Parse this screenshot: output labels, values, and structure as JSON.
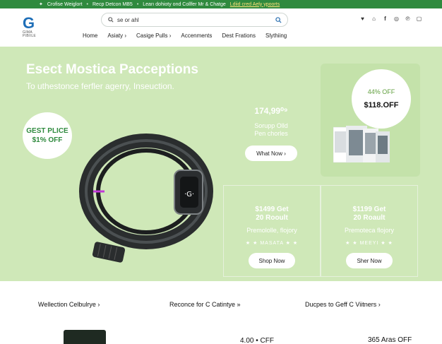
{
  "topbar": {
    "items": [
      "Crofise Weiglort",
      "Recp Detcon MB5",
      "Learı dohioty ond Collfer Mr & Chatge"
    ],
    "highlight": "Ldiid cred Aely ypoorts"
  },
  "header": {
    "logo_letter": "G",
    "logo_text": "GIMA PIBIILE",
    "search": {
      "value": "se or ahl"
    },
    "nav": [
      "Home",
      "Asiaty ›",
      "Casige Pulls ›",
      "Accenments",
      "Dest Frations",
      "Slythiing"
    ],
    "icons": [
      "heart-icon",
      "home-icon",
      "facebook-icon",
      "instagram-icon",
      "pinterest-icon",
      "copy-icon"
    ]
  },
  "hero": {
    "title": "Esect Mostica Pacceptions",
    "subtitle": "To uthestonce ferfler agerry, Inseuction.",
    "badge": {
      "line1": "GEST PLICE",
      "line2": "$1% OFF"
    },
    "promo": {
      "price": "174,99⁰⁹",
      "text1": "Sorupp Olld",
      "text2": "Pen chorles",
      "button": "What Now ›"
    },
    "side": {
      "discount": "44% OFF",
      "price": "$118.OFF"
    },
    "device_mark": "·G·"
  },
  "panels": [
    {
      "price1": "$1499 Get",
      "price2": "20 Rooult",
      "sub": "Premololle, flojory",
      "stars": "★ ★ MASATA ★ ★",
      "button": "Shop Now"
    },
    {
      "price1": "$1199 Get",
      "price2": "20 Roault",
      "sub": "Premoteca flojory",
      "stars": "★ ★ MEEYI ★ ★",
      "button": "Sher Now"
    }
  ],
  "categories": [
    "Wellection Celbulrye ›",
    "Reconce for C Catintye »",
    "Ducpes to Geff C Viitners ›"
  ],
  "bottom": {
    "price": "4.00 • CFF",
    "off": "365 Aras OFF"
  },
  "colors": {
    "topbar": "#2f8a3e",
    "hero": "#cfe8b8",
    "accent": "#2f8a3e"
  }
}
